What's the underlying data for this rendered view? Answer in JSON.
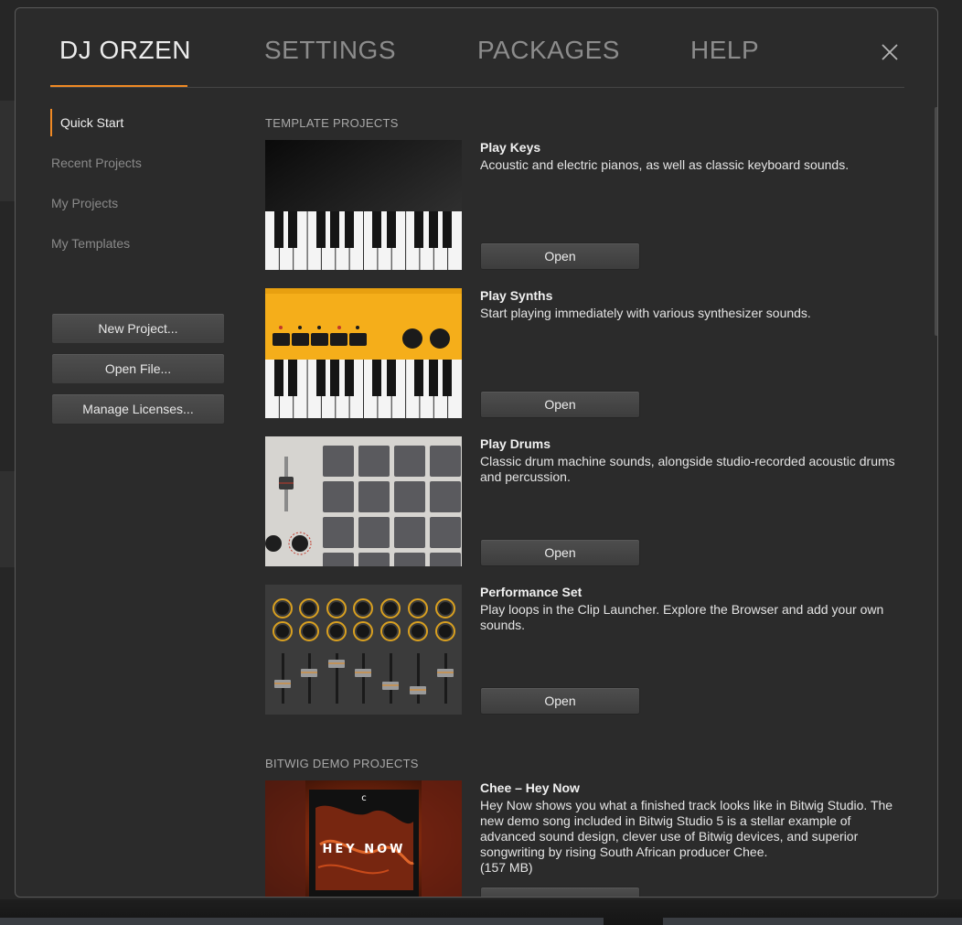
{
  "tabs": [
    {
      "label": "DJ ORZEN",
      "active": true
    },
    {
      "label": "SETTINGS",
      "active": false
    },
    {
      "label": "PACKAGES",
      "active": false
    },
    {
      "label": "HELP",
      "active": false
    }
  ],
  "sidebar": {
    "items": [
      {
        "label": "Quick Start",
        "active": true
      },
      {
        "label": "Recent Projects",
        "active": false
      },
      {
        "label": "My Projects",
        "active": false
      },
      {
        "label": "My Templates",
        "active": false
      }
    ],
    "buttons": {
      "new_project": "New Project...",
      "open_file": "Open File...",
      "manage_licenses": "Manage Licenses..."
    }
  },
  "template_section": {
    "title": "TEMPLATE PROJECTS",
    "projects": [
      {
        "name": "Play Keys",
        "description": "Acoustic and electric pianos, as well as classic keyboard sounds.",
        "button": "Open"
      },
      {
        "name": "Play Synths",
        "description": "Start playing immediately with various synthesizer sounds.",
        "button": "Open"
      },
      {
        "name": "Play Drums",
        "description": "Classic drum machine sounds, alongside studio-recorded acoustic drums and percussion.",
        "button": "Open"
      },
      {
        "name": "Performance Set",
        "description": "Play loops in the Clip Launcher. Explore the Browser and add your own sounds.",
        "button": "Open"
      }
    ]
  },
  "demo_section": {
    "title": "BITWIG DEMO PROJECTS",
    "projects": [
      {
        "name": "Chee – Hey Now",
        "description": "Hey Now shows you what a finished track looks like in Bitwig Studio. The new demo song included in Bitwig Studio 5 is a stellar example of advanced sound design, clever use of Bitwig devices, and superior songwriting by rising South African producer Chee.",
        "size": "(157 MB)",
        "cover_text": "HEY NOW"
      }
    ]
  },
  "colors": {
    "accent": "#f08a24",
    "panel": "#2b2b2b",
    "synth_yellow": "#f5ae1a"
  },
  "icons": {
    "close": "close-icon"
  }
}
